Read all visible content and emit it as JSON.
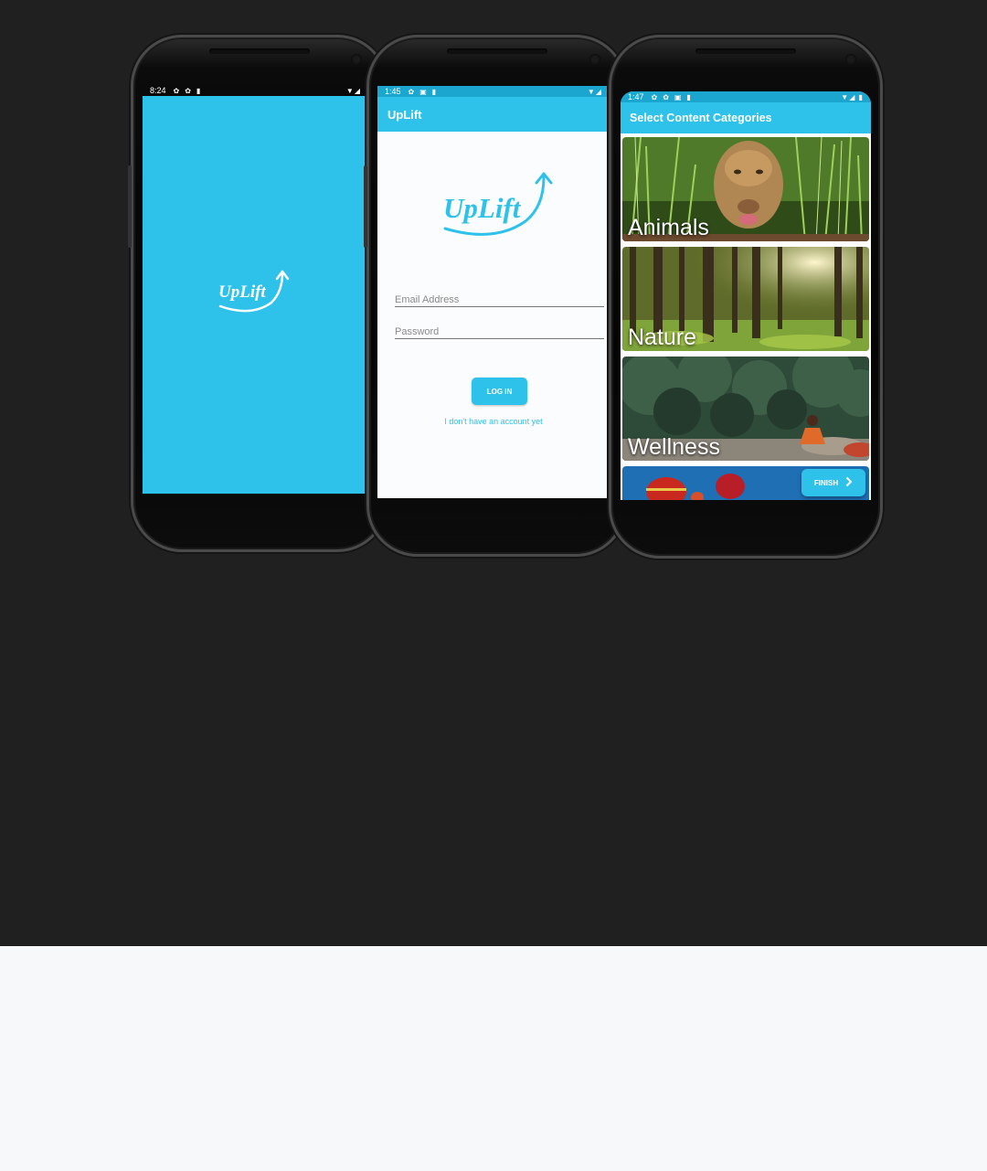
{
  "colors": {
    "brand": "#2ec2ea",
    "status_bar": "#1aa6cf",
    "backdrop": "#202020",
    "page_bottom": "#f7f8f9"
  },
  "phone1": {
    "status": {
      "time": "8:24",
      "icons": [
        "gear-icon",
        "gear-icon",
        "sd-card-icon"
      ],
      "right": "▼◢"
    },
    "logo_text": "UpLift"
  },
  "phone2": {
    "status": {
      "time": "1:45",
      "icons": [
        "gear-icon",
        "square-icon",
        "sd-card-icon"
      ],
      "right": "▼◢"
    },
    "app_title": "UpLift",
    "logo_text": "UpLift",
    "email": {
      "placeholder": "Email Address",
      "value": ""
    },
    "password": {
      "placeholder": "Password",
      "value": ""
    },
    "login_label": "LOG IN",
    "signup_link": "I don't have an account yet"
  },
  "phone3": {
    "status": {
      "time": "1:47",
      "icons": [
        "gear-icon",
        "gear-icon",
        "square-icon",
        "sd-card-icon"
      ],
      "right": "▼◢ ▮"
    },
    "app_title": "Select Content Categories",
    "categories": [
      {
        "label": "Animals"
      },
      {
        "label": "Nature"
      },
      {
        "label": "Wellness"
      },
      {
        "label": ""
      }
    ],
    "finish_label": "FINISH",
    "finish_icon": "chevron-right-icon"
  }
}
